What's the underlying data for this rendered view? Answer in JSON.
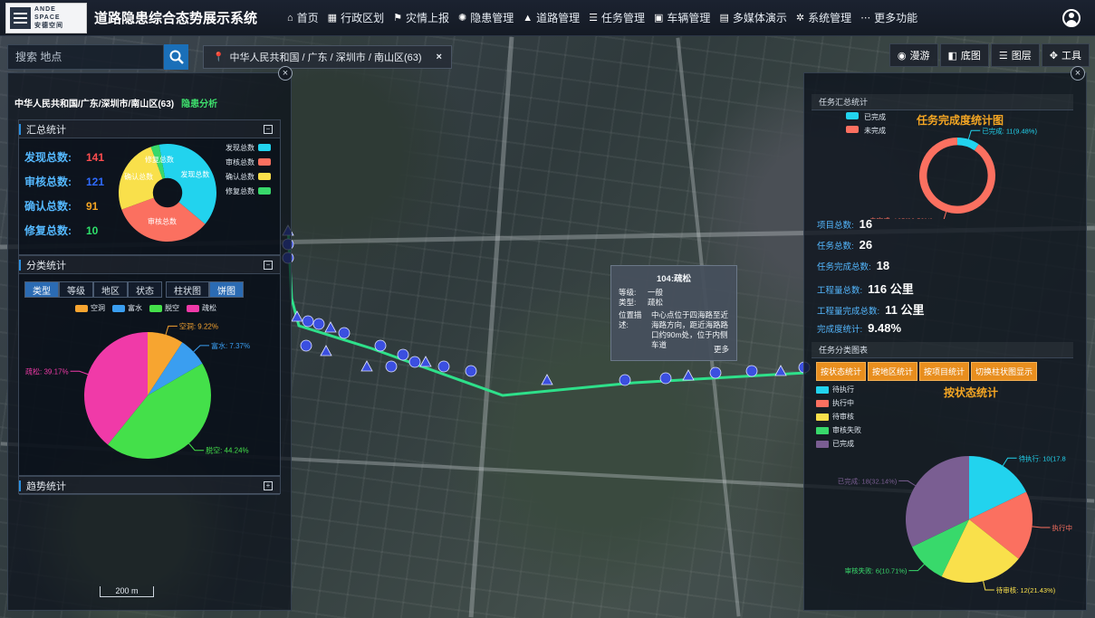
{
  "logo": {
    "en": "ANDE SPACE",
    "cn": "安德空间"
  },
  "app_title": "道路隐患综合态势展示系统",
  "nav": [
    {
      "label": "首页",
      "icon": "home-icon",
      "glyph": "⌂"
    },
    {
      "label": "行政区划",
      "icon": "map-icon",
      "glyph": "▦"
    },
    {
      "label": "灾情上报",
      "icon": "flag-icon",
      "glyph": "⚑"
    },
    {
      "label": "隐患管理",
      "icon": "bug-icon",
      "glyph": "✺"
    },
    {
      "label": "道路管理",
      "icon": "road-icon",
      "glyph": "▲"
    },
    {
      "label": "任务管理",
      "icon": "list-icon",
      "glyph": "☰"
    },
    {
      "label": "车辆管理",
      "icon": "car-icon",
      "glyph": "▣"
    },
    {
      "label": "多媒体演示",
      "icon": "film-icon",
      "glyph": "▤"
    },
    {
      "label": "系统管理",
      "icon": "gear-icon",
      "glyph": "✲"
    },
    {
      "label": "更多功能",
      "icon": "more-icon",
      "glyph": "⋯"
    }
  ],
  "search": {
    "placeholder": "搜索 地点"
  },
  "breadcrumb": "中华人民共和国 / 广东 / 深圳市 / 南山区(63)",
  "map_tools": [
    {
      "label": "漫游",
      "icon": "globe-icon",
      "glyph": "◉"
    },
    {
      "label": "底图",
      "icon": "basemap-icon",
      "glyph": "◧"
    },
    {
      "label": "图层",
      "icon": "layers-icon",
      "glyph": "☰"
    },
    {
      "label": "工具",
      "icon": "tools-icon",
      "glyph": "✥"
    }
  ],
  "left": {
    "region_title": "中华人民共和国/广东/深圳市/南山区(63)",
    "risk_link": "隐患分析",
    "summary_title": "汇总统计",
    "summary": [
      {
        "label": "发现总数:",
        "value": "141",
        "color": "#ff4d4f"
      },
      {
        "label": "审核总数:",
        "value": "121",
        "color": "#2f6bff"
      },
      {
        "label": "确认总数:",
        "value": "91",
        "color": "#f5a623"
      },
      {
        "label": "修复总数:",
        "value": "10",
        "color": "#2ee06a"
      }
    ],
    "summary_legend": [
      {
        "label": "发现总数",
        "color": "#22d3ee"
      },
      {
        "label": "审核总数",
        "color": "#fb7060"
      },
      {
        "label": "确认总数",
        "color": "#f9e04b"
      },
      {
        "label": "修复总数",
        "color": "#38d96b"
      }
    ],
    "class_title": "分类统计",
    "tabs": [
      "类型",
      "等级",
      "地区",
      "状态"
    ],
    "view_tabs": [
      "柱状图",
      "饼图"
    ],
    "class_legend": [
      {
        "label": "空洞",
        "color": "#f7a530"
      },
      {
        "label": "富水",
        "color": "#3a9ef0"
      },
      {
        "label": "脱空",
        "color": "#44e04a"
      },
      {
        "label": "疏松",
        "color": "#f03aa8"
      }
    ],
    "trend_title": "趋势统计"
  },
  "popup": {
    "title": "104:疏松",
    "rows": [
      {
        "k": "等级:",
        "v": "一般"
      },
      {
        "k": "类型:",
        "v": "疏松"
      },
      {
        "k": "位置描述:",
        "v": "中心点位于四海路至近海路方向，距近海路路口约90m处，位于内侧车道"
      }
    ],
    "more": "更多"
  },
  "right": {
    "task_summary_title": "任务汇总统计",
    "completion_chart_title": "任务完成度统计图",
    "stats": [
      {
        "label": "项目总数:",
        "value": "16"
      },
      {
        "label": "任务总数:",
        "value": "26"
      },
      {
        "label": "任务完成总数:",
        "value": "18"
      },
      {
        "label": "工程量总数:",
        "value": "116 公里"
      },
      {
        "label": "工程量完成总数:",
        "value": "11 公里"
      },
      {
        "label": "完成度统计:",
        "value": "9.48%"
      }
    ],
    "category_title": "任务分类图表",
    "buttons": [
      "按状态统计",
      "按地区统计",
      "按项目统计",
      "切换柱状图显示"
    ],
    "status_chart_title": "按状态统计",
    "status_legend": [
      {
        "label": "待执行",
        "color": "#22d3ee"
      },
      {
        "label": "执行中",
        "color": "#fb7060"
      },
      {
        "label": "待审核",
        "color": "#f9e04b"
      },
      {
        "label": "审核失败",
        "color": "#38d96b"
      },
      {
        "label": "已完成",
        "color": "#7a5e92"
      }
    ]
  },
  "scale_label": "200 m",
  "chart_data": [
    {
      "type": "pie",
      "name": "summary",
      "categories": [
        "发现总数",
        "审核总数",
        "确认总数",
        "修复总数"
      ],
      "values": [
        141,
        121,
        91,
        10
      ],
      "colors": [
        "#22d3ee",
        "#fb7060",
        "#f9e04b",
        "#38d96b"
      ],
      "slice_labels": [
        "发现总数",
        "审核总数",
        "确认总数",
        "修复总数"
      ],
      "inner_radius_fraction": 0.3
    },
    {
      "type": "pie",
      "name": "classification",
      "categories": [
        "空洞",
        "富水",
        "脱空",
        "疏松"
      ],
      "values": [
        9.22,
        7.37,
        44.24,
        39.17
      ],
      "colors": [
        "#f7a530",
        "#3a9ef0",
        "#44e04a",
        "#f03aa8"
      ],
      "slice_labels": [
        "空洞: 9.22%",
        "富水: 7.37%",
        "脱空: 44.24%",
        "疏松: 39.17%"
      ]
    },
    {
      "type": "pie",
      "name": "completion",
      "categories": [
        "已完成",
        "未完成"
      ],
      "values": [
        11,
        105
      ],
      "colors": [
        "#22d3ee",
        "#fb7060"
      ],
      "slice_labels": [
        "已完成: 11(9.48%)",
        "未完成: 105(90.52%)"
      ],
      "inner_radius_fraction": 0.8
    },
    {
      "type": "pie",
      "name": "status",
      "categories": [
        "待执行",
        "执行中",
        "待审核",
        "审核失败",
        "已完成"
      ],
      "values": [
        10,
        10,
        12,
        6,
        18
      ],
      "colors": [
        "#22d3ee",
        "#fb7060",
        "#f9e04b",
        "#38d96b",
        "#7a5e92"
      ],
      "slice_labels": [
        "待执行: 10(17.8",
        "执行中",
        "待审核: 12(21.43%)",
        "审核失败: 6(10.71%)",
        "已完成: 18(32.14%)"
      ]
    }
  ]
}
